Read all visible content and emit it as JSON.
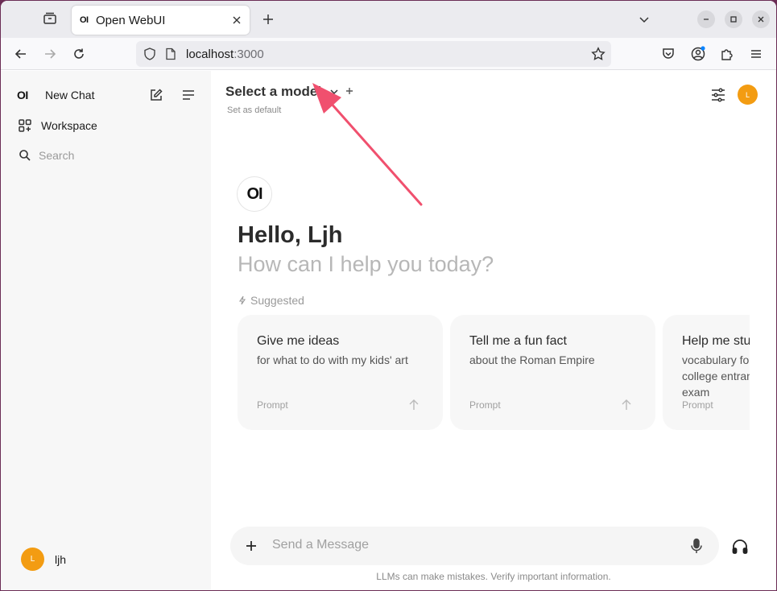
{
  "browser": {
    "tab_title": "Open WebUI",
    "tab_favicon_text": "OI",
    "url_host": "localhost",
    "url_port": ":3000"
  },
  "sidebar": {
    "logo_text": "OI",
    "new_chat_label": "New Chat",
    "workspace_label": "Workspace",
    "search_placeholder": "Search",
    "user_initial": "L",
    "user_name": "ljh"
  },
  "header": {
    "model_select_label": "Select a model",
    "set_default_label": "Set as default",
    "user_initial": "L"
  },
  "welcome": {
    "logo_text": "OI",
    "greeting": "Hello, Ljh",
    "subtitle": "How can I help you today?",
    "suggested_label": "Suggested"
  },
  "suggestions": [
    {
      "title": "Give me ideas",
      "subtitle": "for what to do with my kids' art",
      "tag": "Prompt"
    },
    {
      "title": "Tell me a fun fact",
      "subtitle": "about the Roman Empire",
      "tag": "Prompt"
    },
    {
      "title": "Help me study",
      "subtitle": "vocabulary for a college entrance exam",
      "tag": "Prompt"
    }
  ],
  "composer": {
    "placeholder": "Send a Message"
  },
  "footer": {
    "disclaimer": "LLMs can make mistakes. Verify important information."
  },
  "colors": {
    "avatar": "#f39c12",
    "annotation_arrow": "#f0506e",
    "desktop_bg": "#6b2d55"
  }
}
